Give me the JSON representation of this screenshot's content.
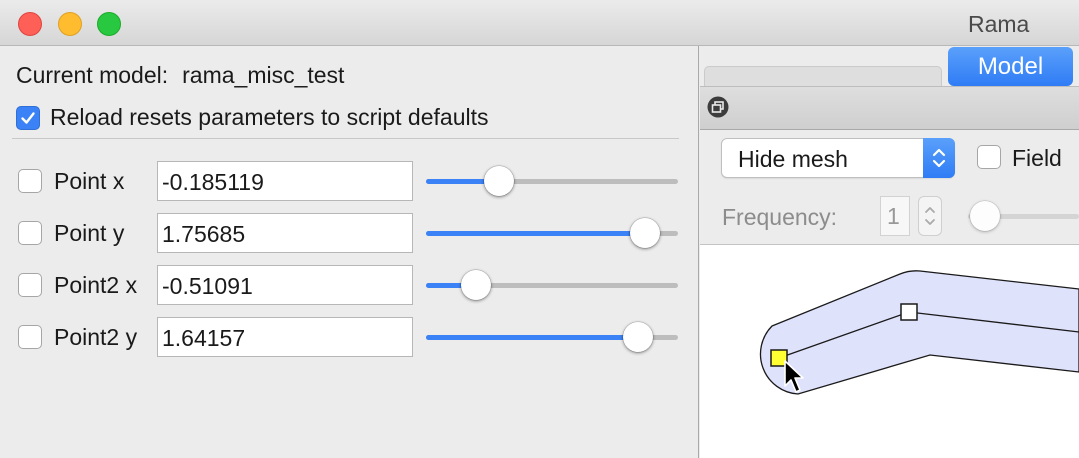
{
  "window": {
    "title": "Rama"
  },
  "left_panel": {
    "current_model_label": "Current model:",
    "current_model_value": "rama_misc_test",
    "reload_label": "Reload resets parameters to script defaults",
    "reload_checked": true,
    "params": [
      {
        "label": "Point x",
        "value": "-0.185119",
        "checked": false,
        "slider_fraction": 0.29
      },
      {
        "label": "Point y",
        "value": "1.75685",
        "checked": false,
        "slider_fraction": 0.87
      },
      {
        "label": "Point2 x",
        "value": "-0.51091",
        "checked": false,
        "slider_fraction": 0.2
      },
      {
        "label": "Point2 y",
        "value": "1.64157",
        "checked": false,
        "slider_fraction": 0.84
      }
    ]
  },
  "right_panel": {
    "tab_active": "Model",
    "mesh_select_value": "Hide mesh",
    "field_label": "Field",
    "field_checked": false,
    "frequency_label": "Frequency:",
    "frequency_value": "1"
  },
  "colors": {
    "accent": "#3b82f6",
    "shape_fill": "#dfe2fb",
    "selected_point": "#ffff33"
  },
  "icons": [
    "restore-window-icon",
    "chevron-updown-icon",
    "checkmark-icon",
    "mouse-pointer-icon"
  ]
}
